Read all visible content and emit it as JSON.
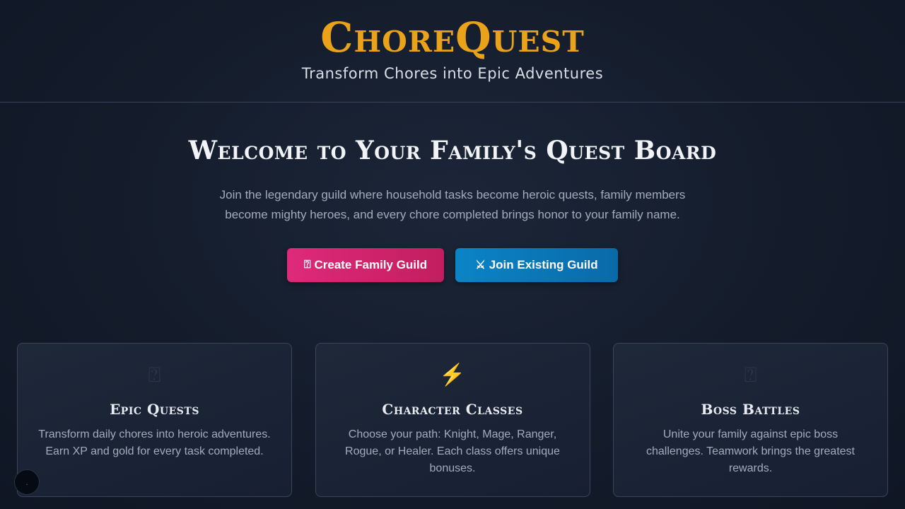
{
  "header": {
    "logo": "ChoreQuest",
    "tagline": "Transform Chores into Epic Adventures"
  },
  "hero": {
    "title": "Welcome to Your Family's Quest Board",
    "intro": "Join the legendary guild where household tasks become heroic quests, family members become mighty heroes, and every chore completed brings honor to your family name."
  },
  "actions": {
    "create": {
      "icon": "⍰",
      "icon_name": "scroll-icon",
      "label": "Create Family Guild",
      "color": "#de2a7a"
    },
    "join": {
      "icon": "⚔",
      "icon_name": "swords-icon",
      "label": "Join Existing Guild",
      "color": "#0a84c6"
    }
  },
  "features": [
    {
      "icon": "⍰",
      "icon_name": "quest-icon",
      "title": "Epic Quests",
      "text": "Transform daily chores into heroic adventures. Earn XP and gold for every task completed."
    },
    {
      "icon": "⚡",
      "icon_name": "lightning-icon",
      "title": "Character Classes",
      "text": "Choose your path: Knight, Mage, Ranger, Rogue, or Healer. Each class offers unique bonuses."
    },
    {
      "icon": "⍰",
      "icon_name": "boss-icon",
      "title": "Boss Battles",
      "text": "Unite your family against epic boss challenges. Teamwork brings the greatest rewards."
    }
  ],
  "colors": {
    "accent": "#eba21b",
    "background": "#141c2b"
  }
}
